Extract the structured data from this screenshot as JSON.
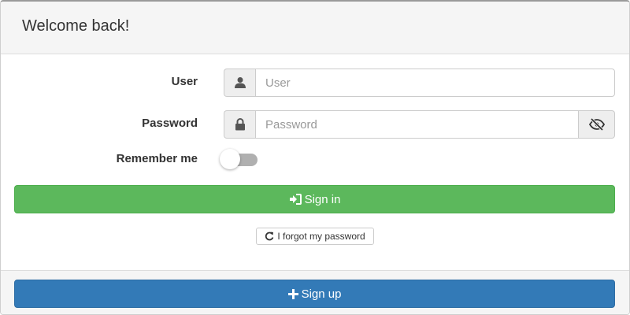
{
  "header": {
    "title": "Welcome back!"
  },
  "form": {
    "user": {
      "label": "User",
      "placeholder": "User",
      "value": "",
      "icon": "user-icon"
    },
    "password": {
      "label": "Password",
      "placeholder": "Password",
      "value": "",
      "icon": "lock-icon",
      "toggle_icon": "eye-slash-icon"
    },
    "remember": {
      "label": "Remember me",
      "checked": false
    }
  },
  "actions": {
    "sign_in_label": "Sign in",
    "sign_in_icon": "sign-in-icon",
    "forgot_label": "I forgot my password",
    "forgot_icon": "refresh-icon",
    "sign_up_label": "Sign up",
    "sign_up_icon": "plus-icon"
  },
  "colors": {
    "success": "#5cb85c",
    "primary": "#337ab7",
    "panel_bg": "#f5f5f5"
  }
}
